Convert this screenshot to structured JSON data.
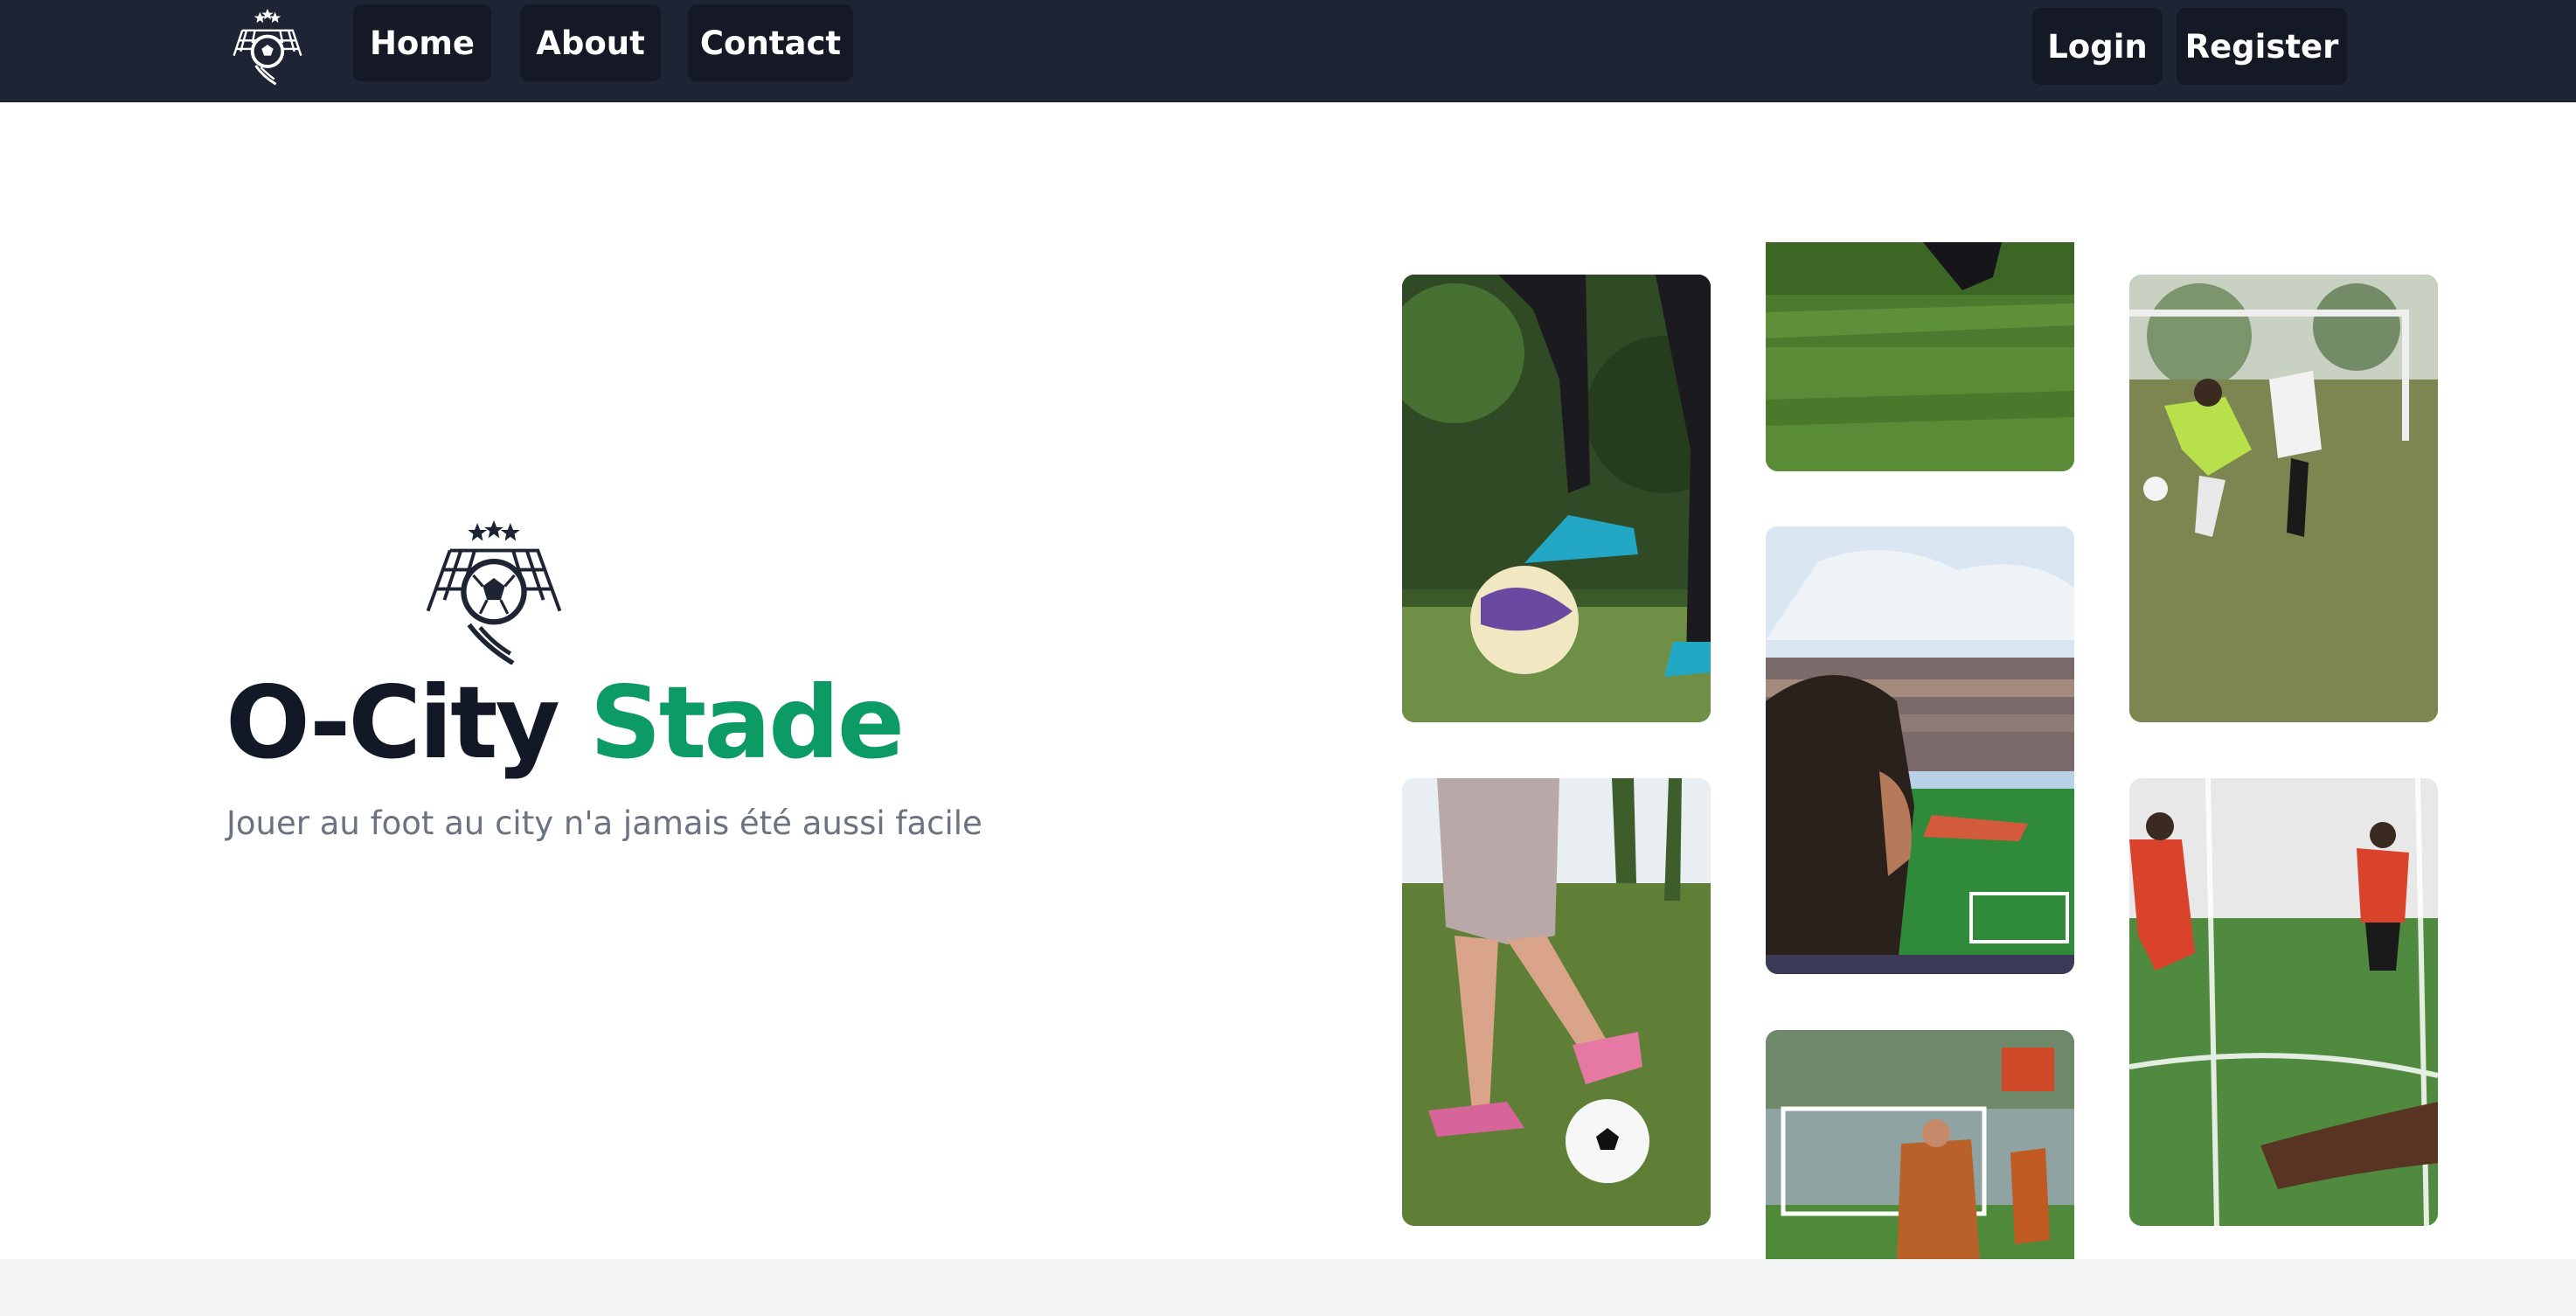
{
  "nav": {
    "home_label": "Home",
    "about_label": "About",
    "contact_label": "Contact",
    "login_label": "Login",
    "register_label": "Register"
  },
  "hero": {
    "title_part1": "O-City",
    "title_part2": "Stade",
    "subtitle": "Jouer au foot au city n'a jamais été aussi facile"
  },
  "colors": {
    "navbar_bg": "#1e2433",
    "button_bg": "#141925",
    "title_dark": "#121826",
    "title_green": "#0c9b64",
    "subtitle_gray": "#6b7280",
    "footer_band": "#f3f4f6"
  },
  "icons": {
    "brand_logo": "soccer-ball-goal-stars-icon"
  }
}
